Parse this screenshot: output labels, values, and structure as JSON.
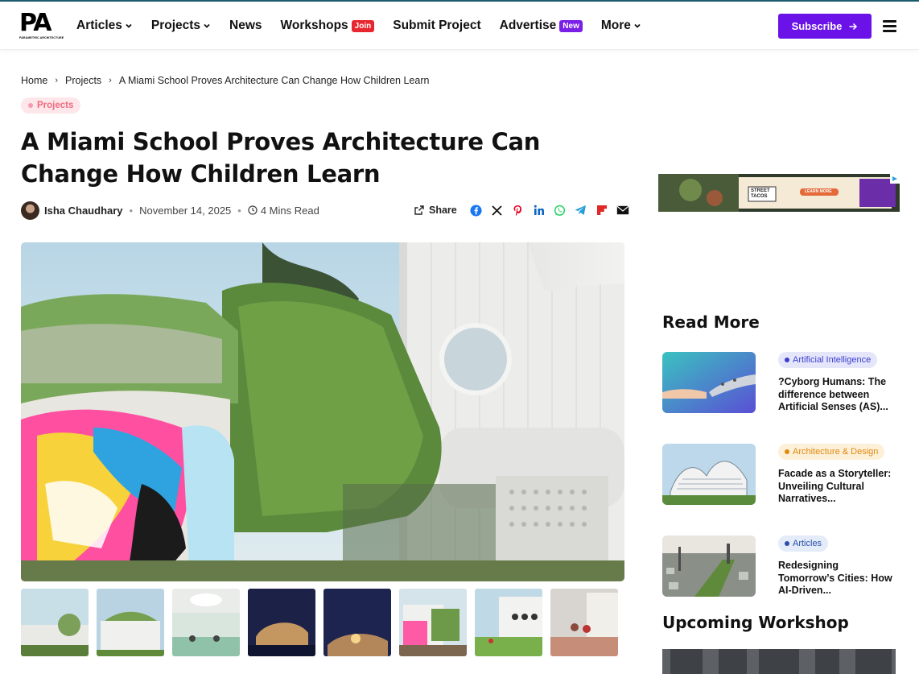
{
  "header": {
    "logo_text": "PA",
    "logo_sub": "PARAMETRIC ARCHITECTURE",
    "nav": [
      {
        "label": "Articles",
        "has_dropdown": true
      },
      {
        "label": "Projects",
        "has_dropdown": true
      },
      {
        "label": "News",
        "has_dropdown": false
      },
      {
        "label": "Workshops",
        "badge": "Join",
        "badge_color": "#e8262f"
      },
      {
        "label": "Submit Project",
        "has_dropdown": false
      },
      {
        "label": "Advertise",
        "badge": "New",
        "badge_color": "#7a1fe6"
      },
      {
        "label": "More",
        "has_dropdown": true
      }
    ],
    "subscribe_label": "Subscribe",
    "accent": "#6a12e8"
  },
  "breadcrumb": [
    "Home",
    "Projects",
    "A Miami School Proves Architecture Can Change How Children Learn"
  ],
  "article": {
    "category": "Projects",
    "title": "A Miami School Proves Architecture Can Change How Children Learn",
    "author": "Isha Chaudhary",
    "date": "November 14, 2025",
    "read_time": "4 Mins Read",
    "share_label": "Share",
    "share_icons": [
      "facebook-icon",
      "x-icon",
      "pinterest-icon",
      "linkedin-icon",
      "whatsapp-icon",
      "telegram-icon",
      "flipboard-icon",
      "email-icon"
    ]
  },
  "sidebar": {
    "read_more_heading": "Read More",
    "items": [
      {
        "tag": "Artificial Intelligence",
        "tag_color": "#3b3ecf",
        "tag_bg": "#e6e6fb",
        "title": "?Cyborg Humans: The difference between Artificial Senses (AS)..."
      },
      {
        "tag": "Architecture & Design",
        "tag_color": "#e08a12",
        "tag_bg": "#fdf0d8",
        "title": "Facade as a Storyteller: Unveiling Cultural Narratives..."
      },
      {
        "tag": "Articles",
        "tag_color": "#2b4ea8",
        "tag_bg": "#e3ecf8",
        "title": "Redesigning Tomorrow’s Cities: How AI-Driven..."
      }
    ],
    "upcoming_heading": "Upcoming Workshop",
    "ad_text": [
      "STREET TACOS",
      "LEARN MORE"
    ]
  }
}
